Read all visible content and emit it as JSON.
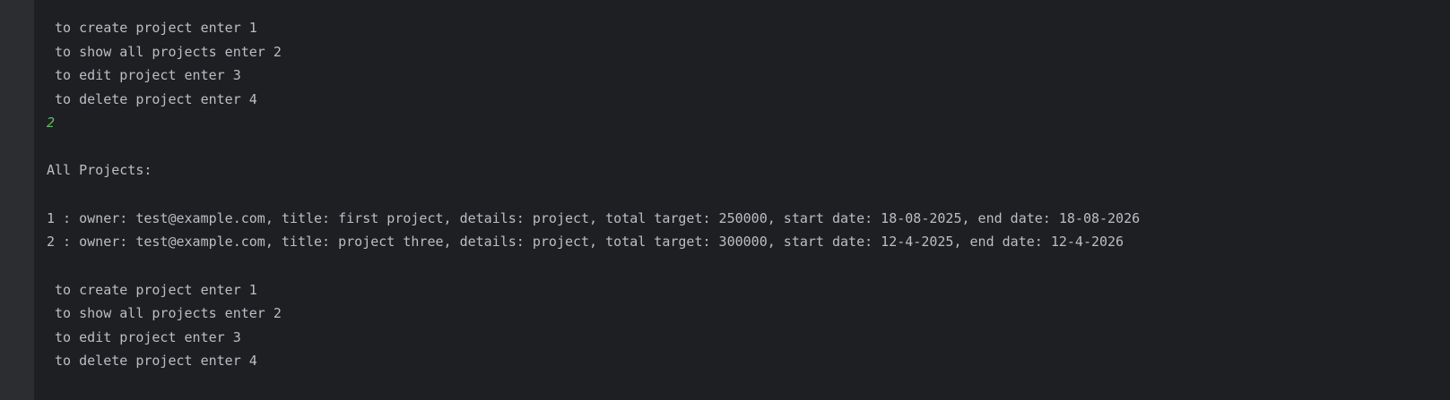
{
  "console": {
    "menu_top": [
      " to create project enter 1",
      " to show all projects enter 2",
      " to edit project enter 3",
      " to delete project enter 4"
    ],
    "user_input": "2",
    "header": "All Projects:",
    "projects": [
      "1 : owner: test@example.com, title: first project, details: project, total target: 250000, start date: 18-08-2025, end date: 18-08-2026",
      "2 : owner: test@example.com, title: project three, details: project, total target: 300000, start date: 12-4-2025, end date: 12-4-2026"
    ],
    "menu_bottom": [
      " to create project enter 1",
      " to show all projects enter 2",
      " to edit project enter 3",
      " to delete project enter 4"
    ],
    "colors": {
      "background": "#1e1f22",
      "gutter": "#2b2d30",
      "text": "#bcbec4",
      "user_input": "#5fb865"
    }
  }
}
